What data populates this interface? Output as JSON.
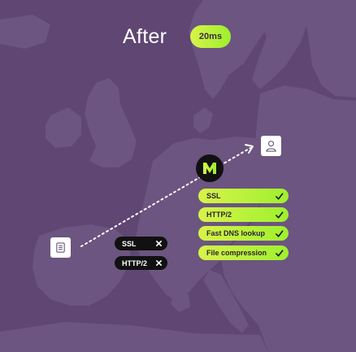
{
  "header": {
    "title": "After",
    "latency": "20ms"
  },
  "colors": {
    "background": "#5f4673",
    "land": "#6c5580",
    "accent_start": "#d8f349",
    "accent_end": "#9ef02e",
    "dark": "#111111"
  },
  "icons": {
    "user": "user-icon",
    "server": "server-icon",
    "logo": "m-logo-icon",
    "check": "check-icon",
    "cross": "x-icon"
  },
  "features_enabled": [
    {
      "label": "SSL"
    },
    {
      "label": "HTTP/2"
    },
    {
      "label": "Fast DNS lookup"
    },
    {
      "label": "File compression"
    }
  ],
  "features_origin": [
    {
      "label": "SSL"
    },
    {
      "label": "HTTP/2"
    }
  ]
}
